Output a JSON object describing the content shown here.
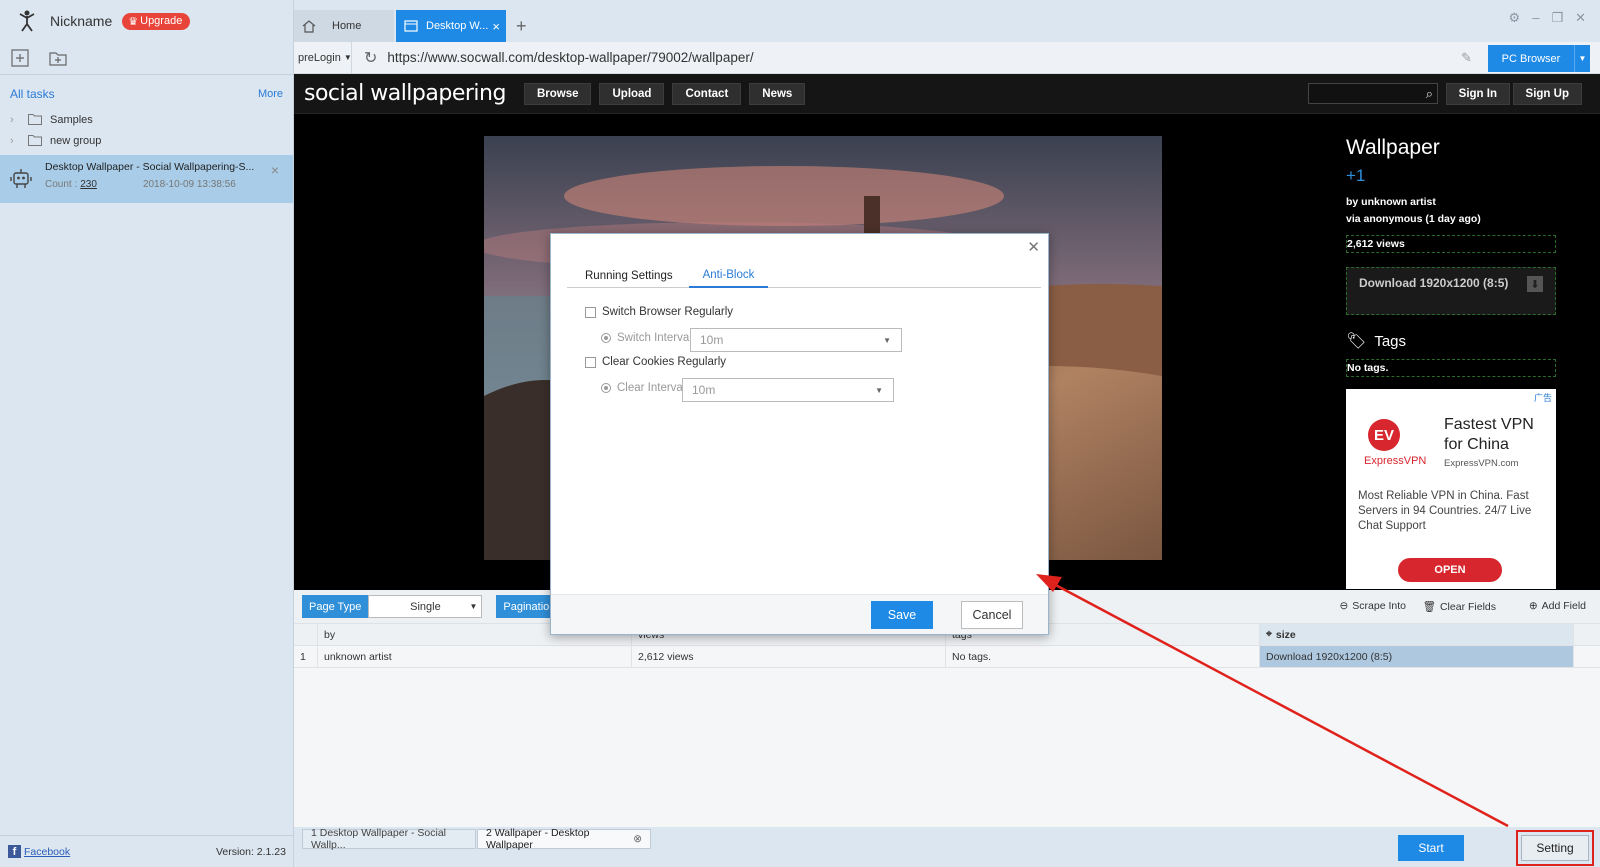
{
  "sidebar": {
    "nickname": "Nickname",
    "upgrade_label": "Upgrade",
    "all_tasks_label": "All tasks",
    "more_label": "More",
    "groups": [
      {
        "label": "Samples"
      },
      {
        "label": "new group"
      }
    ],
    "task": {
      "title": "Desktop Wallpaper - Social Wallpapering-S...",
      "count_label": "Count :",
      "count": "230",
      "date": "2018-10-09 13:38:56"
    },
    "facebook_label": "Facebook",
    "version": "Version: 2.1.23"
  },
  "tabs": {
    "home_label": "Home",
    "active_label": "Desktop W..."
  },
  "address": {
    "prelogin_label": "preLogin",
    "url": "https://www.socwall.com/desktop-wallpaper/79002/wallpaper/",
    "pc_browser_label": "PC Browser"
  },
  "site": {
    "logo": "social wallpapering",
    "nav": [
      "Browse",
      "Upload",
      "Contact",
      "News"
    ],
    "signin_label": "Sign In",
    "signup_label": "Sign Up",
    "wallpaper_title": "Wallpaper",
    "plus": "+1",
    "by_line": "by unknown artist",
    "via_line": "via anonymous (1 day ago)",
    "views": "2,612 views",
    "download_label": "Download 1920x1200 (8:5)",
    "tags_label": "Tags",
    "no_tags": "No tags.",
    "ad": {
      "mark": "广告",
      "logo_letters": "EV",
      "brand": "ExpressVPN",
      "headline": "Fastest VPN for China",
      "site": "ExpressVPN.com",
      "body": "Most Reliable VPN in China. Fast Servers in 94 Countries. 24/7 Live Chat Support",
      "cta": "OPEN"
    }
  },
  "config": {
    "page_type_label": "Page Type",
    "page_type_value": "Single",
    "pagination_label": "Pagination",
    "scrape_into_label": "Scrape Into",
    "clear_fields_label": "Clear Fields",
    "add_field_label": "Add Field"
  },
  "table": {
    "columns": [
      "by",
      "views",
      "tags",
      "size"
    ],
    "rows": [
      {
        "index": "1",
        "by": "unknown artist",
        "views": "2,612 views",
        "tags": "No tags.",
        "size": "Download 1920x1200 (8:5)"
      }
    ]
  },
  "bottom": {
    "tab1_label": "1 Desktop Wallpaper - Social Wallp...",
    "tab2_label": "2 Wallpaper - Desktop Wallpaper",
    "start_label": "Start",
    "setting_label": "Setting"
  },
  "modal": {
    "tab_running": "Running Settings",
    "tab_anti_block": "Anti-Block",
    "switch_browser_label": "Switch Browser Regularly",
    "switch_interval_label": "Switch Interval",
    "switch_interval_value": "10m",
    "clear_cookies_label": "Clear Cookies Regularly",
    "clear_interval_label": "Clear Interval",
    "clear_interval_value": "10m",
    "save_label": "Save",
    "cancel_label": "Cancel"
  }
}
